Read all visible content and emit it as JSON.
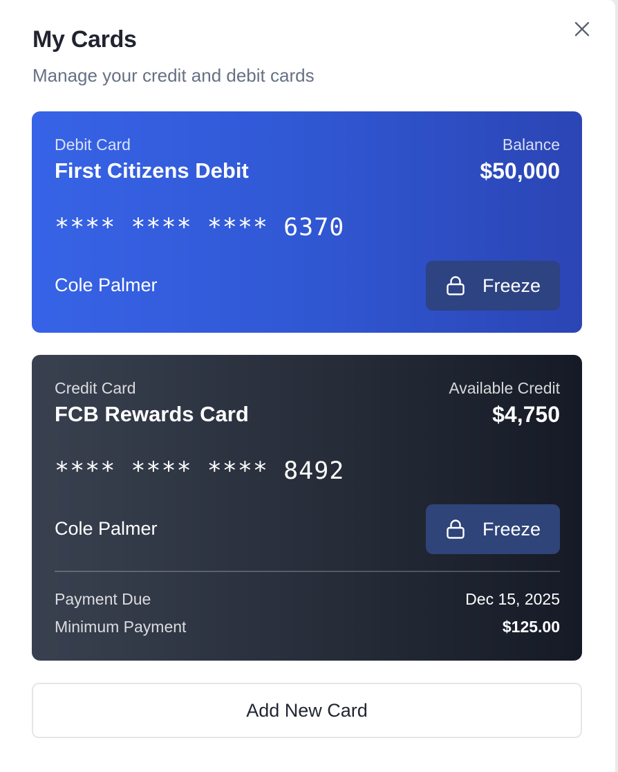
{
  "header": {
    "title": "My Cards",
    "subtitle": "Manage your credit and debit cards"
  },
  "close_icon": "close-icon",
  "cards": [
    {
      "type_label": "Debit Card",
      "name": "First Citizens Debit",
      "amount_label": "Balance",
      "amount": "$50,000",
      "number": "**** **** **** 6370",
      "holder": "Cole Palmer",
      "freeze_label": "Freeze",
      "freeze_icon": "lock-icon",
      "accent": "#3763e6"
    },
    {
      "type_label": "Credit Card",
      "name": "FCB Rewards Card",
      "amount_label": "Available Credit",
      "amount": "$4,750",
      "number": "**** **** **** 8492",
      "holder": "Cole Palmer",
      "freeze_label": "Freeze",
      "freeze_icon": "lock-icon",
      "accent": "#262c38",
      "payment_due_label": "Payment Due",
      "payment_due": "Dec 15, 2025",
      "minimum_payment_label": "Minimum Payment",
      "minimum_payment": "$125.00"
    }
  ],
  "add_card_label": "Add New Card"
}
